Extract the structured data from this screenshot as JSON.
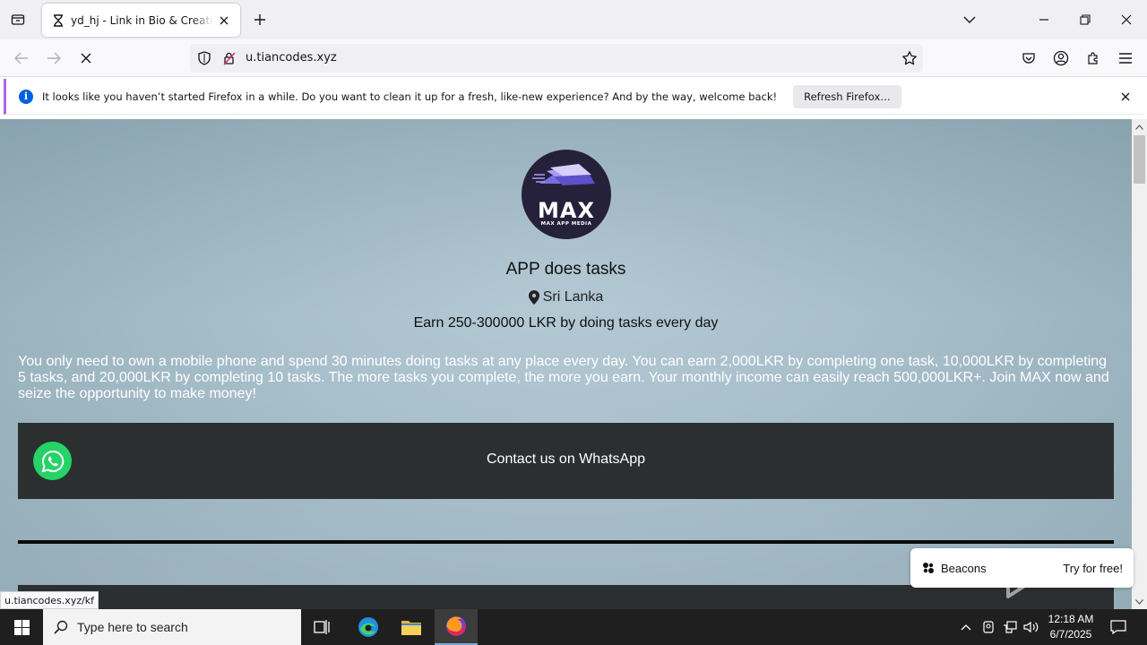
{
  "browser": {
    "tab": {
      "title": "yd_hj - Link in Bio & Creator Tools | Beacons"
    },
    "url": {
      "host": "u.tiancodes.xyz"
    },
    "notification": {
      "message": "It looks like you haven’t started Firefox in a while. Do you want to clean it up for a fresh, like-new experience? And by the way, welcome back!",
      "button": "Refresh Firefox…"
    },
    "status_url": "u.tiancodes.xyz/kf"
  },
  "page": {
    "logo": {
      "brand": "MAX",
      "subtitle": "MAX APP MEDIA"
    },
    "headline": "APP does tasks",
    "location": "Sri Lanka",
    "tagline": "Earn 250-300000 LKR by doing tasks every day",
    "description": "You only need to own a mobile phone and spend 30 minutes doing tasks at any place every day. You can earn 2,000LKR by completing one task, 10,000LKR by completing 5 tasks, and 20,000LKR by completing 10 tasks. The more tasks you complete, the more you earn. Your monthly income can easily reach 500,000LKR+. Join MAX now and seize the opportunity to make money!",
    "whatsapp_label": "Contact us on WhatsApp",
    "beacons_badge": {
      "name": "Beacons",
      "cta": "Try for free!"
    }
  },
  "taskbar": {
    "search_placeholder": "Type here to search",
    "time": "12:18 AM",
    "date": "6/7/2025"
  },
  "colors": {
    "whatsapp_green": "#25d366",
    "card_dark": "#2b2f30",
    "firefox_accent": "#0060df"
  }
}
